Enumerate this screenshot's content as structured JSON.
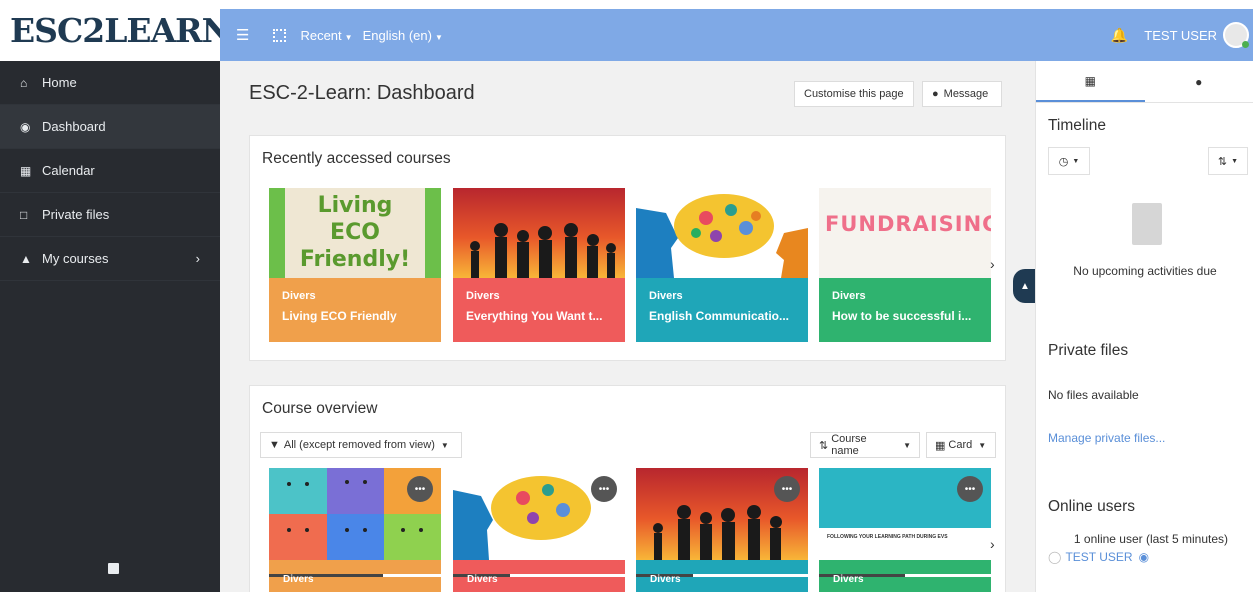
{
  "logo": {
    "text": "ESC2LEARN"
  },
  "navbar": {
    "recent_label": "Recent",
    "language_label": "English (en)",
    "user_name": "TEST USER"
  },
  "sidebar": {
    "items": [
      {
        "label": "Home",
        "icon": "home-icon"
      },
      {
        "label": "Dashboard",
        "icon": "dashboard-icon"
      },
      {
        "label": "Calendar",
        "icon": "calendar-icon"
      },
      {
        "label": "Private files",
        "icon": "file-icon"
      },
      {
        "label": "My courses",
        "icon": "graduation-cap-icon"
      }
    ]
  },
  "main": {
    "page_title": "ESC-2-Learn: Dashboard",
    "customise_label": "Customise this page",
    "message_label": "Message",
    "recent": {
      "title": "Recently accessed courses",
      "courses": [
        {
          "category": "Divers",
          "name": "Living ECO Friendly",
          "color": "#f0a04b",
          "image_text": "Living ECO Friendly!"
        },
        {
          "category": "Divers",
          "name": "Everything You Want t...",
          "color": "#ef5b5b",
          "image_text": ""
        },
        {
          "category": "Divers",
          "name": "English Communicatio...",
          "color": "#1fa6b8",
          "image_text": ""
        },
        {
          "category": "Divers",
          "name": "How to be successful i...",
          "color": "#2fb36f",
          "image_text": "FUNDRAISING"
        }
      ]
    },
    "overview": {
      "title": "Course overview",
      "filter_label": "All (except removed from view)",
      "sort_label": "Course name",
      "view_label": "Card",
      "cards": [
        {
          "category": "Divers",
          "color": "#f0a04b",
          "progress": 0.66
        },
        {
          "category": "Divers",
          "color": "#ef5b5b",
          "progress": 0.33
        },
        {
          "category": "Divers",
          "color": "#1fa6b8",
          "progress": 0.33
        },
        {
          "category": "Divers",
          "color": "#2fb36f",
          "progress": 0.5,
          "image_text": "FOLLOWING YOUR LEARNING PATH DURING EVS"
        }
      ]
    }
  },
  "drawer": {
    "timeline_title": "Timeline",
    "no_activities": "No upcoming activities due",
    "private_files_title": "Private files",
    "no_files": "No files available",
    "manage_files": "Manage private files...",
    "online_users_title": "Online users",
    "online_count": "1 online user (last 5 minutes)",
    "online_user": "TEST USER"
  }
}
